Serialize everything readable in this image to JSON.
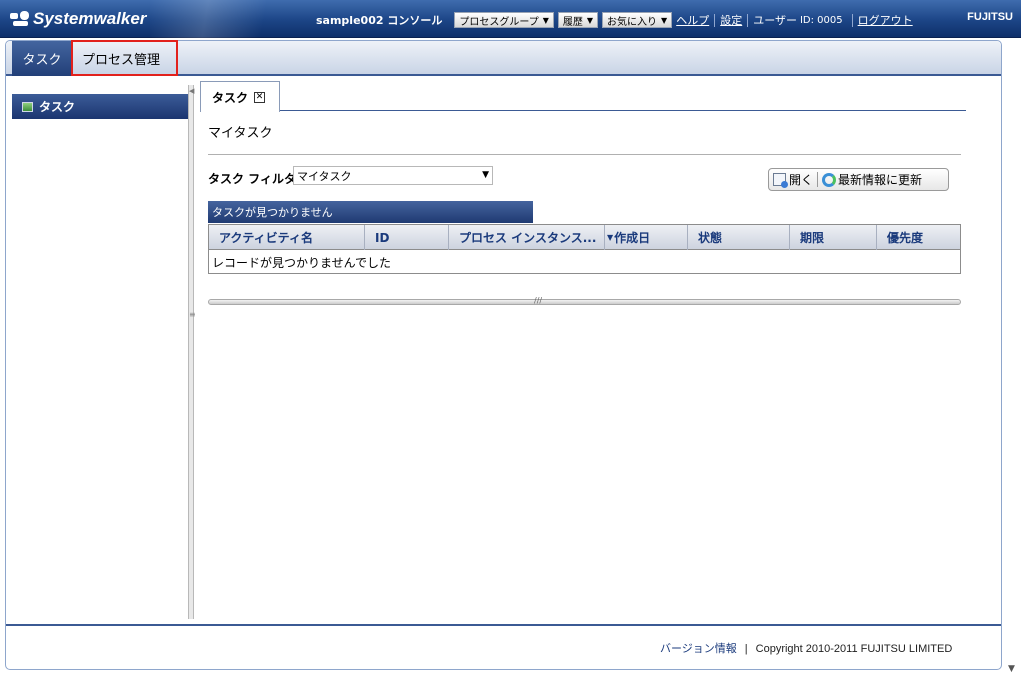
{
  "header": {
    "brand": "Systemwalker",
    "console_title": "sample002 コンソール",
    "menus": [
      {
        "label": "プロセスグループ"
      },
      {
        "label": "履歴"
      },
      {
        "label": "お気に入り"
      }
    ],
    "help_link": "ヘルプ",
    "settings_link": "設定",
    "user_label": "ユーザー",
    "user_id": "ID: 0005",
    "logout_link": "ログアウト",
    "vendor_logo": "FUJITSU"
  },
  "main_tabs": [
    {
      "label": "タスク",
      "active": true
    },
    {
      "label": "プロセス管理",
      "active": false
    }
  ],
  "sidebar": {
    "items": [
      {
        "label": "タスク",
        "icon": "task-list-icon"
      }
    ]
  },
  "content": {
    "tab_label": "タスク",
    "page_title": "マイタスク",
    "filter_label": "タスク フィルタ",
    "filter_value": "マイタスク",
    "actions": {
      "open_label": "開く",
      "refresh_label": "最新情報に更新"
    },
    "grid": {
      "caption": "タスクが見つかりません",
      "columns": [
        "アクティビティ名",
        "ID",
        "プロセス インスタンス...",
        "作成日",
        "状態",
        "期限",
        "優先度"
      ],
      "sorted_column": "作成日",
      "empty_message": "レコードが見つかりませんでした"
    }
  },
  "footer": {
    "version_link": "バージョン情報",
    "copyright": "Copyright 2010-2011 FUJITSU LIMITED"
  },
  "colors": {
    "header_bg": "#1c4586",
    "accent": "#223f78",
    "highlight_box": "#e2211c"
  }
}
